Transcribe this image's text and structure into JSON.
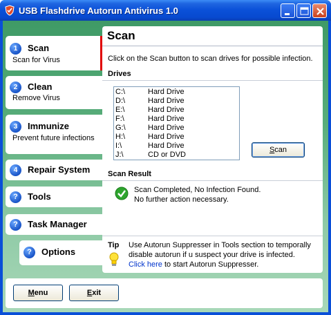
{
  "window": {
    "title": "USB Flashdrive Autorun Antivirus 1.0",
    "controls": [
      "minimize",
      "maximize",
      "close"
    ]
  },
  "sidebar": {
    "items": [
      {
        "number": "1",
        "label": "Scan",
        "sublabel": "Scan for Virus",
        "selected": true
      },
      {
        "number": "2",
        "label": "Clean",
        "sublabel": "Remove Virus"
      },
      {
        "number": "3",
        "label": "Immunize",
        "sublabel": "Prevent future infections"
      },
      {
        "number": "4",
        "label": "Repair System"
      },
      {
        "icon": "help-icon",
        "label": "Tools"
      },
      {
        "icon": "help-icon",
        "label": "Task Manager"
      },
      {
        "icon": "help-icon",
        "label": "Options"
      }
    ]
  },
  "main": {
    "title": "Scan",
    "instruction": "Click on the Scan button to scan drives for possible infection.",
    "drives_heading": "Drives",
    "drives": [
      {
        "letter": "C:\\",
        "type": "Hard Drive"
      },
      {
        "letter": "D:\\",
        "type": "Hard Drive"
      },
      {
        "letter": "E:\\",
        "type": "Hard Drive"
      },
      {
        "letter": "F:\\",
        "type": "Hard Drive"
      },
      {
        "letter": "G:\\",
        "type": "Hard Drive"
      },
      {
        "letter": "H:\\",
        "type": "Hard Drive"
      },
      {
        "letter": "I:\\",
        "type": "Hard Drive"
      },
      {
        "letter": "J:\\",
        "type": "CD or DVD"
      }
    ],
    "scan_button": {
      "label": "Scan",
      "mnemonic": "S",
      "rest": "can"
    },
    "result_heading": "Scan Result",
    "result_line1": "Scan Completed, No Infection Found.",
    "result_line2": "No further action necessary.",
    "tip_label": "Tip",
    "tip_line1": "Use Autorun Suppresser in Tools section to temporally",
    "tip_line2": "disable autorun if u suspect your drive is infected.",
    "tip_link": "Click here",
    "tip_line3_rest": " to start Autorun Suppresser."
  },
  "footer": {
    "menu_button": {
      "label": "Menu",
      "mnemonic": "M",
      "rest": "enu"
    },
    "exit_button": {
      "label": "Exit",
      "mnemonic": "E",
      "rest": "xit"
    }
  },
  "colors": {
    "titlebar": "#0a50d8",
    "sidebar_bg": "#58ad7a",
    "selected_marker": "#e00000",
    "success": "#2ea52e",
    "link": "#0033cc"
  }
}
